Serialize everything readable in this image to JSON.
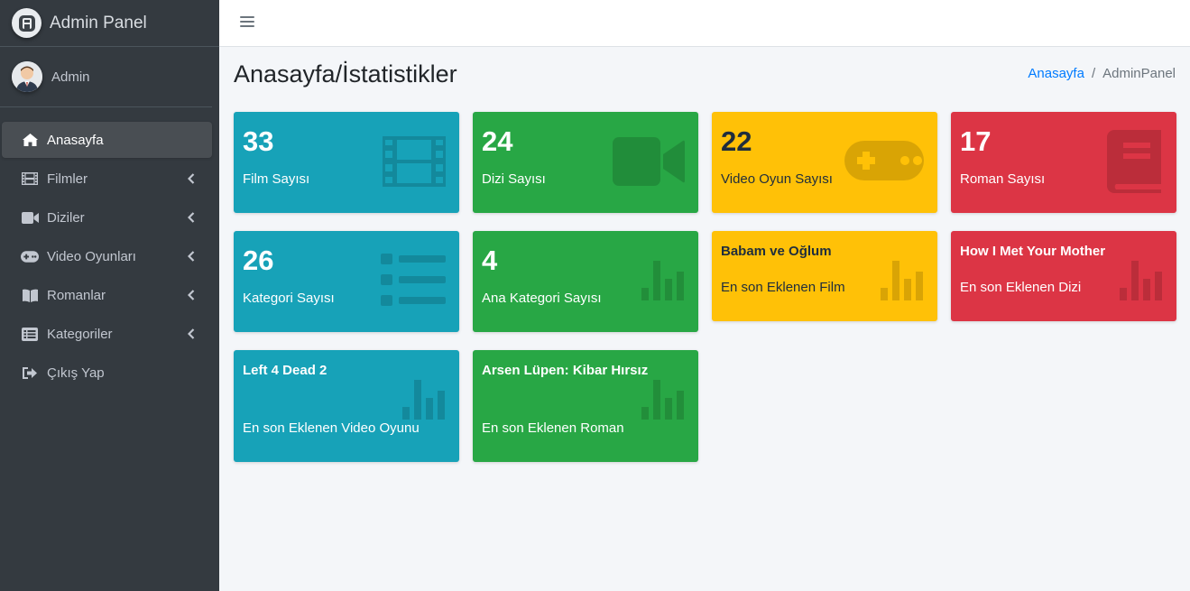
{
  "brand": {
    "title": "Admin Panel"
  },
  "user": {
    "name": "Admin"
  },
  "nav": [
    {
      "label": "Anasayfa",
      "icon": "home-icon",
      "active": true
    },
    {
      "label": "Filmler",
      "icon": "film-icon"
    },
    {
      "label": "Diziler",
      "icon": "video-icon"
    },
    {
      "label": "Video Oyunları",
      "icon": "gamepad-icon"
    },
    {
      "label": "Romanlar",
      "icon": "book-icon"
    },
    {
      "label": "Kategoriler",
      "icon": "list-icon"
    },
    {
      "label": "Çıkış Yap",
      "icon": "sign-out-icon"
    }
  ],
  "header": {
    "title": "Anasayfa/İstatistikler",
    "breadcrumb": {
      "home": "Anasayfa",
      "separator": "/",
      "current": "AdminPanel"
    }
  },
  "stats": [
    {
      "value": "33",
      "label": "Film Sayısı",
      "color": "#17a2b8",
      "icon": "film-icon"
    },
    {
      "value": "24",
      "label": "Dizi Sayısı",
      "color": "#28a745",
      "icon": "video-icon"
    },
    {
      "value": "22",
      "label": "Video Oyun Sayısı",
      "color": "#ffc107",
      "icon": "gamepad-icon"
    },
    {
      "value": "17",
      "label": "Roman Sayısı",
      "color": "#dc3545",
      "icon": "book-icon"
    },
    {
      "value": "26",
      "label": "Kategori Sayısı",
      "color": "#17a2b8",
      "icon": "list-icon"
    },
    {
      "value": "4",
      "label": "Ana Kategori Sayısı",
      "color": "#28a745",
      "icon": "bar-chart-icon"
    }
  ],
  "latest": [
    {
      "title": "Babam ve Oğlum",
      "label": "En son Eklenen Film",
      "color": "#ffc107",
      "icon": "bar-chart-icon"
    },
    {
      "title": "How I Met Your Mother",
      "label": "En son Eklenen Dizi",
      "color": "#dc3545",
      "icon": "bar-chart-icon"
    },
    {
      "title": "Left 4 Dead 2",
      "label": "En son Eklenen Video Oyunu",
      "color": "#17a2b8",
      "icon": "bar-chart-icon"
    },
    {
      "title": "Arsen Lüpen: Kibar Hırsız",
      "label": "En son Eklenen Roman",
      "color": "#28a745",
      "icon": "bar-chart-icon"
    }
  ]
}
